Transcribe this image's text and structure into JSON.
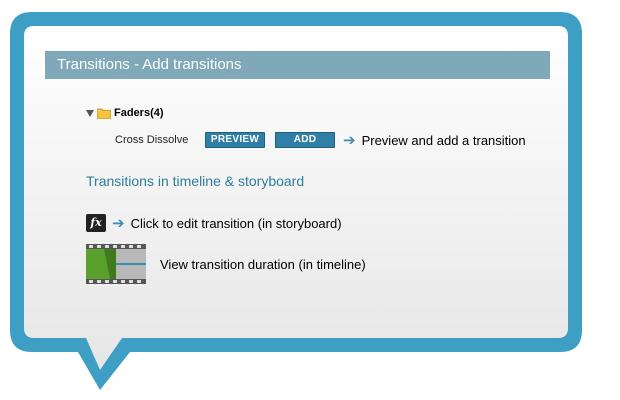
{
  "colors": {
    "bubble_border": "#3f9ec4",
    "header_bg": "#7fa9b8",
    "accent": "#2f7fa6",
    "section_title": "#2e7d9e"
  },
  "header": {
    "title": "Transitions - Add transitions"
  },
  "tree": {
    "folder_label": "Faders(4)",
    "folder_icon": "folder-icon",
    "item_label": "Cross Dissolve",
    "preview_label": "PREVIEW",
    "add_label": "ADD",
    "hint": "Preview and add a transition"
  },
  "section": {
    "title": "Transitions in timeline & storyboard"
  },
  "fx": {
    "icon": "fx-icon",
    "icon_text": "fx",
    "hint": "Click to edit transition (in storyboard)"
  },
  "timeline": {
    "icon": "timeline-clip-icon",
    "hint": "View transition duration (in timeline)"
  }
}
